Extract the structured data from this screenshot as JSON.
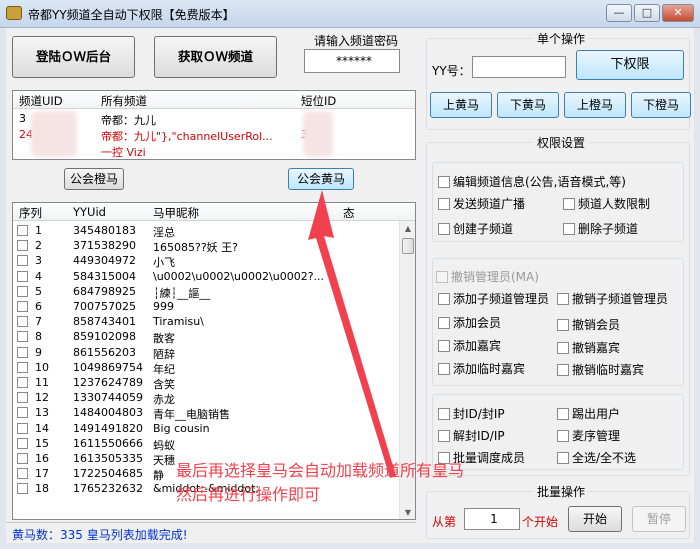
{
  "window": {
    "title": "帝都YY频道全自动下权限【免费版本】",
    "minimize_glyph": "—",
    "maximize_glyph": "□",
    "close_glyph": "✕"
  },
  "left_top": {
    "login_button": "登陆ＯＷ后台",
    "fetch_button": "获取ＯＷ频道",
    "password_label": "请输入频道密码",
    "password_value": "******"
  },
  "channel_list": {
    "headers": [
      "频道UID",
      "所有频道",
      "短位ID"
    ],
    "rows": [
      {
        "uid": "3",
        "name": "帝都：九儿",
        "short": "",
        "red": false
      },
      {
        "uid": "24",
        "name": "帝都：九儿\"},\"channelUserRol...",
        "short": "3",
        "red": true
      },
      {
        "uid": "",
        "name": "一控 Vizi",
        "short": "",
        "red": true
      }
    ]
  },
  "member_buttons": {
    "orange_horse": "公会橙马",
    "yellow_horse": "公会黄马"
  },
  "member_list": {
    "headers": [
      "序列",
      "YYUid",
      "马甲昵称",
      "态"
    ],
    "rows": [
      {
        "n": "1",
        "uid": "345480183",
        "nick": "淫总"
      },
      {
        "n": "2",
        "uid": "371538290",
        "nick": "165085??妖 王?"
      },
      {
        "n": "3",
        "uid": "449304972",
        "nick": "小飞"
      },
      {
        "n": "4",
        "uid": "584315004",
        "nick": "\\u0002\\u0002\\u0002\\u0002?..."
      },
      {
        "n": "5",
        "uid": "684798925",
        "nick": "┆練┆__謳__"
      },
      {
        "n": "6",
        "uid": "700757025",
        "nick": "999"
      },
      {
        "n": "7",
        "uid": "858743401",
        "nick": "Tiramisu\\"
      },
      {
        "n": "8",
        "uid": "859102098",
        "nick": "散客"
      },
      {
        "n": "9",
        "uid": "861556203",
        "nick": "陋辞"
      },
      {
        "n": "10",
        "uid": "1049869754",
        "nick": "年纪"
      },
      {
        "n": "11",
        "uid": "1237624789",
        "nick": "含笑"
      },
      {
        "n": "12",
        "uid": "1330744059",
        "nick": "赤龙"
      },
      {
        "n": "13",
        "uid": "1484004803",
        "nick": "青年__电脑销售"
      },
      {
        "n": "14",
        "uid": "1491491820",
        "nick": "Big cousin"
      },
      {
        "n": "15",
        "uid": "1611550666",
        "nick": "蚂蚁"
      },
      {
        "n": "16",
        "uid": "1613505335",
        "nick": "天穗"
      },
      {
        "n": "17",
        "uid": "1722504685",
        "nick": "静"
      },
      {
        "n": "18",
        "uid": "1765232632",
        "nick": "&middot;-&middot;"
      }
    ]
  },
  "status": {
    "text": "黄马数：335 皇马列表加载完成!"
  },
  "annotation": {
    "line1": "最后再选择皇马会自动加载频道所有皇马",
    "line2": "然后再进行操作即可"
  },
  "single_op": {
    "title": "单个操作",
    "yy_label": "YY号：",
    "yy_value": "",
    "down_button": "下权限",
    "up_yellow": "上黄马",
    "down_yellow": "下黄马",
    "up_orange": "上橙马",
    "down_orange": "下橙马"
  },
  "perm_settings": {
    "title": "权限设置",
    "group1": [
      {
        "label": "编辑频道信息(公告,语音模式,等)"
      },
      {
        "label": "发送频道广播"
      },
      {
        "label": "频道人数限制"
      },
      {
        "label": "创建子频道"
      },
      {
        "label": "删除子频道"
      }
    ],
    "revoke_admin": "撤销管理员(MA)",
    "group2": [
      {
        "label": "添加子频道管理员"
      },
      {
        "label": "撤销子频道管理员"
      },
      {
        "label": "添加会员"
      },
      {
        "label": "撤销会员"
      },
      {
        "label": "添加嘉宾"
      },
      {
        "label": "撤销嘉宾"
      },
      {
        "label": "添加临时嘉宾"
      },
      {
        "label": "撤销临时嘉宾"
      }
    ],
    "group3": [
      {
        "label": "封ID/封IP"
      },
      {
        "label": "踢出用户"
      },
      {
        "label": "解封ID/IP"
      },
      {
        "label": "麦序管理"
      },
      {
        "label": "批量调度成员"
      },
      {
        "label": "全选/全不选"
      }
    ]
  },
  "batch_op": {
    "title": "批量操作",
    "from_label": "从第",
    "start_value": "1",
    "suffix_label": "个开始",
    "start_button": "开始",
    "pause_button": "暂停"
  },
  "colors": {
    "accent_red": "#d40000",
    "annotation_red": "#f2414e",
    "status_blue": "#0033cc"
  }
}
